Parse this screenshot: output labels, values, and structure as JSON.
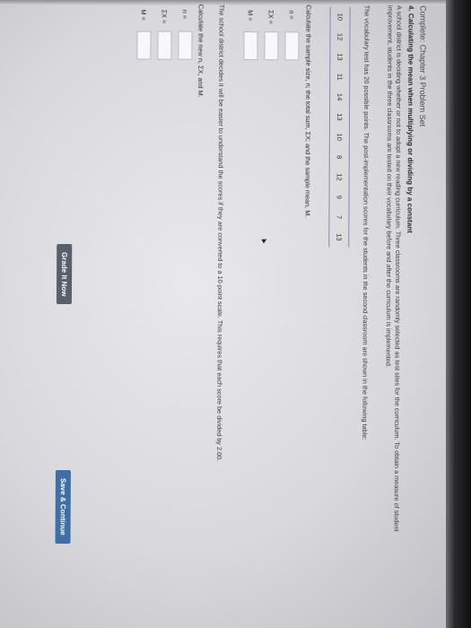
{
  "header": {
    "title": "Complete: Chapter 3 Problem Set"
  },
  "question": {
    "title": "4. Calculating the mean when multiplying or dividing by a constant",
    "intro": "A school district is deciding whether or not to adopt a new reading curriculum. Three classrooms are randomly selected as test sites for the curriculum. To obtain a measure of student improvement, students in the three classrooms are tested on their vocabulary before and after the curriculum is implemented.",
    "table_intro": "The vocabulary test has 20 possible points. The post-implementation scores for the students in the second classroom are shown in the following table:",
    "scores": [
      "10",
      "12",
      "13",
      "11",
      "14",
      "13",
      "10",
      "8",
      "12",
      "9",
      "7",
      "13"
    ],
    "part1_prompt": "Calculate the sample size, n; the total sum, ΣX; and the sample mean, M.",
    "part1_labels": {
      "n": "n =",
      "sumx": "ΣX =",
      "m": "M ="
    },
    "part2_text": "The school district decides it will be easier to understand the scores if they are converted to a 10-point scale. This requires that each score be divided by 2.00.",
    "part2_prompt": "Calculate the new n, ΣX, and M.",
    "part2_labels": {
      "n": "n =",
      "sumx": "ΣX =",
      "m": "M ="
    }
  },
  "buttons": {
    "grade": "Grade It Now",
    "save": "Save & Continue"
  }
}
